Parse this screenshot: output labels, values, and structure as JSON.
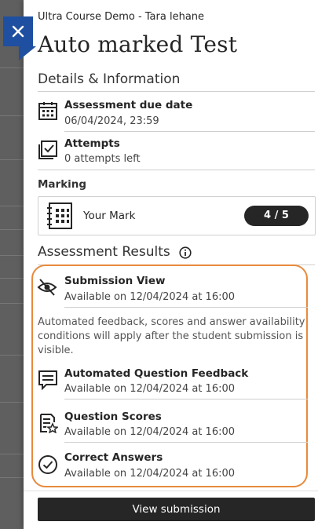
{
  "header": {
    "breadcrumb": "Ultra Course Demo - Tara lehane",
    "title": "Auto marked Test"
  },
  "details": {
    "heading": "Details & Information",
    "due": {
      "title": "Assessment due date",
      "value": "06/04/2024, 23:59",
      "icon": "calendar-icon"
    },
    "attempts": {
      "title": "Attempts",
      "value": "0 attempts left",
      "icon": "attempts-icon"
    }
  },
  "marking": {
    "label": "Marking",
    "your_mark_label": "Your Mark",
    "score": "4 / 5"
  },
  "results": {
    "heading": "Assessment Results",
    "submission_view": {
      "title": "Submission View",
      "value": "Available on 12/04/2024 at 16:00"
    },
    "note": "Automated feedback, scores and answer availability conditions will apply after the student submission is visible.",
    "question_feedback": {
      "title": "Automated Question Feedback",
      "value": "Available on 12/04/2024 at 16:00"
    },
    "question_scores": {
      "title": "Question Scores",
      "value": "Available on 12/04/2024 at 16:00"
    },
    "correct_answers": {
      "title": "Correct Answers",
      "value": "Available on 12/04/2024 at 16:00"
    }
  },
  "footer": {
    "view_submission_label": "View submission"
  },
  "colors": {
    "accent_blue": "#1f4fa0",
    "highlight_orange": "#e88a3c",
    "dark": "#262626"
  }
}
